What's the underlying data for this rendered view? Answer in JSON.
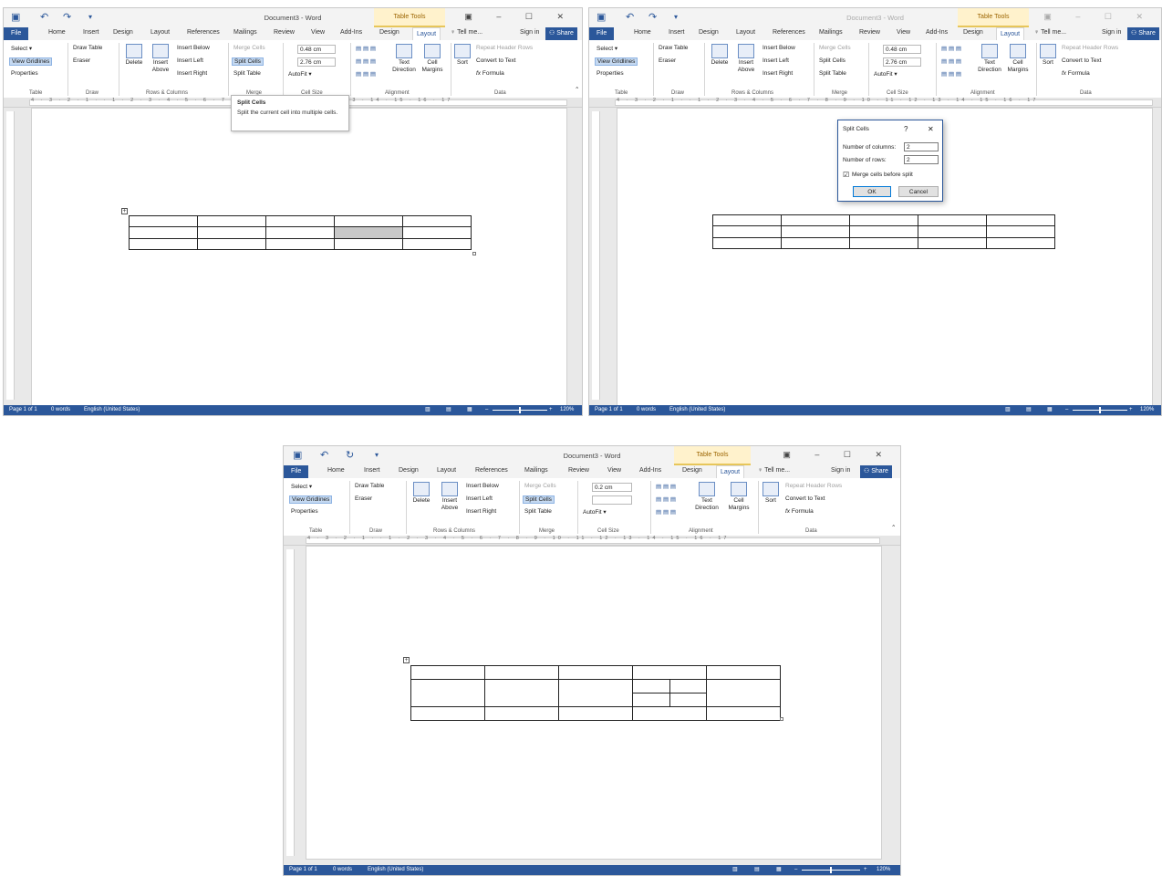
{
  "windows": [
    {
      "id": "w1",
      "title": "Document3 - Word",
      "contextual_tab": "Table Tools",
      "tabs": [
        "File",
        "Home",
        "Insert",
        "Design",
        "Layout",
        "References",
        "Mailings",
        "Review",
        "View",
        "Add-Ins",
        "Design",
        "Layout"
      ],
      "tell_me": "Tell me...",
      "sign_in": "Sign in",
      "share": "Share",
      "height_value": "0.48 cm",
      "width_value": "2.76 cm",
      "tooltip": {
        "title": "Split Cells",
        "body": "Split the current cell into multiple cells."
      },
      "status": {
        "page": "Page 1 of 1",
        "words": "0 words",
        "lang": "English (United States)",
        "zoom": "120%"
      }
    },
    {
      "id": "w2",
      "title": "Document3 - Word",
      "contextual_tab": "Table Tools",
      "tabs": [
        "File",
        "Home",
        "Insert",
        "Design",
        "Layout",
        "References",
        "Mailings",
        "Review",
        "View",
        "Add-Ins",
        "Design",
        "Layout"
      ],
      "tell_me": "Tell me...",
      "sign_in": "Sign in",
      "share": "Share",
      "height_value": "0.48 cm",
      "width_value": "2.76 cm",
      "dialog": {
        "title": "Split Cells",
        "help": "?",
        "close": "✕",
        "cols_label": "Number of columns:",
        "cols_value": "2",
        "rows_label": "Number of rows:",
        "rows_value": "2",
        "merge_label": "Merge cells before split",
        "merge_checked": true,
        "ok": "OK",
        "cancel": "Cancel"
      },
      "status": {
        "page": "Page 1 of 1",
        "words": "0 words",
        "lang": "English (United States)",
        "zoom": "120%"
      }
    },
    {
      "id": "w3",
      "title": "Document3 - Word",
      "contextual_tab": "Table Tools",
      "tabs": [
        "File",
        "Home",
        "Insert",
        "Design",
        "Layout",
        "References",
        "Mailings",
        "Review",
        "View",
        "Add-Ins",
        "Design",
        "Layout"
      ],
      "tell_me": "Tell me...",
      "sign_in": "Sign in",
      "share": "Share",
      "height_value": "0.2 cm",
      "width_value": "",
      "status": {
        "page": "Page 1 of 1",
        "words": "0 words",
        "lang": "English (United States)",
        "zoom": "120%"
      }
    }
  ],
  "ribbon": {
    "select": "Select ▾",
    "view_gridlines": "View Gridlines",
    "properties": "Properties",
    "draw_table": "Draw Table",
    "eraser": "Eraser",
    "delete": "Delete",
    "insert_above": "Insert Above",
    "insert_below": "Insert Below",
    "insert_left": "Insert Left",
    "insert_right": "Insert Right",
    "merge_cells": "Merge Cells",
    "split_cells": "Split Cells",
    "split_table": "Split Table",
    "autofit": "AutoFit ▾",
    "text_direction": "Text Direction",
    "cell_margins": "Cell Margins",
    "sort": "Sort",
    "repeat_header_rows": "Repeat Header Rows",
    "convert_to_text": "Convert to Text",
    "formula": "Formula",
    "groups": {
      "table": "Table",
      "draw": "Draw",
      "rows_columns": "Rows & Columns",
      "merge": "Merge",
      "cell_size": "Cell Size",
      "alignment": "Alignment",
      "data": "Data"
    }
  },
  "ruler_numbers": "4 · 3 · 2 · 1 · · 1 · 2 · 3 · 4 · 5 · 6 · 7 · 8 · 9 · 10 · 11 · 12 · 13 · 14 · 15 · 16 · 17",
  "colors": {
    "word_blue": "#2b579a",
    "table_tools": "#fff2cc",
    "selected_cell": "#c8c8c8"
  }
}
